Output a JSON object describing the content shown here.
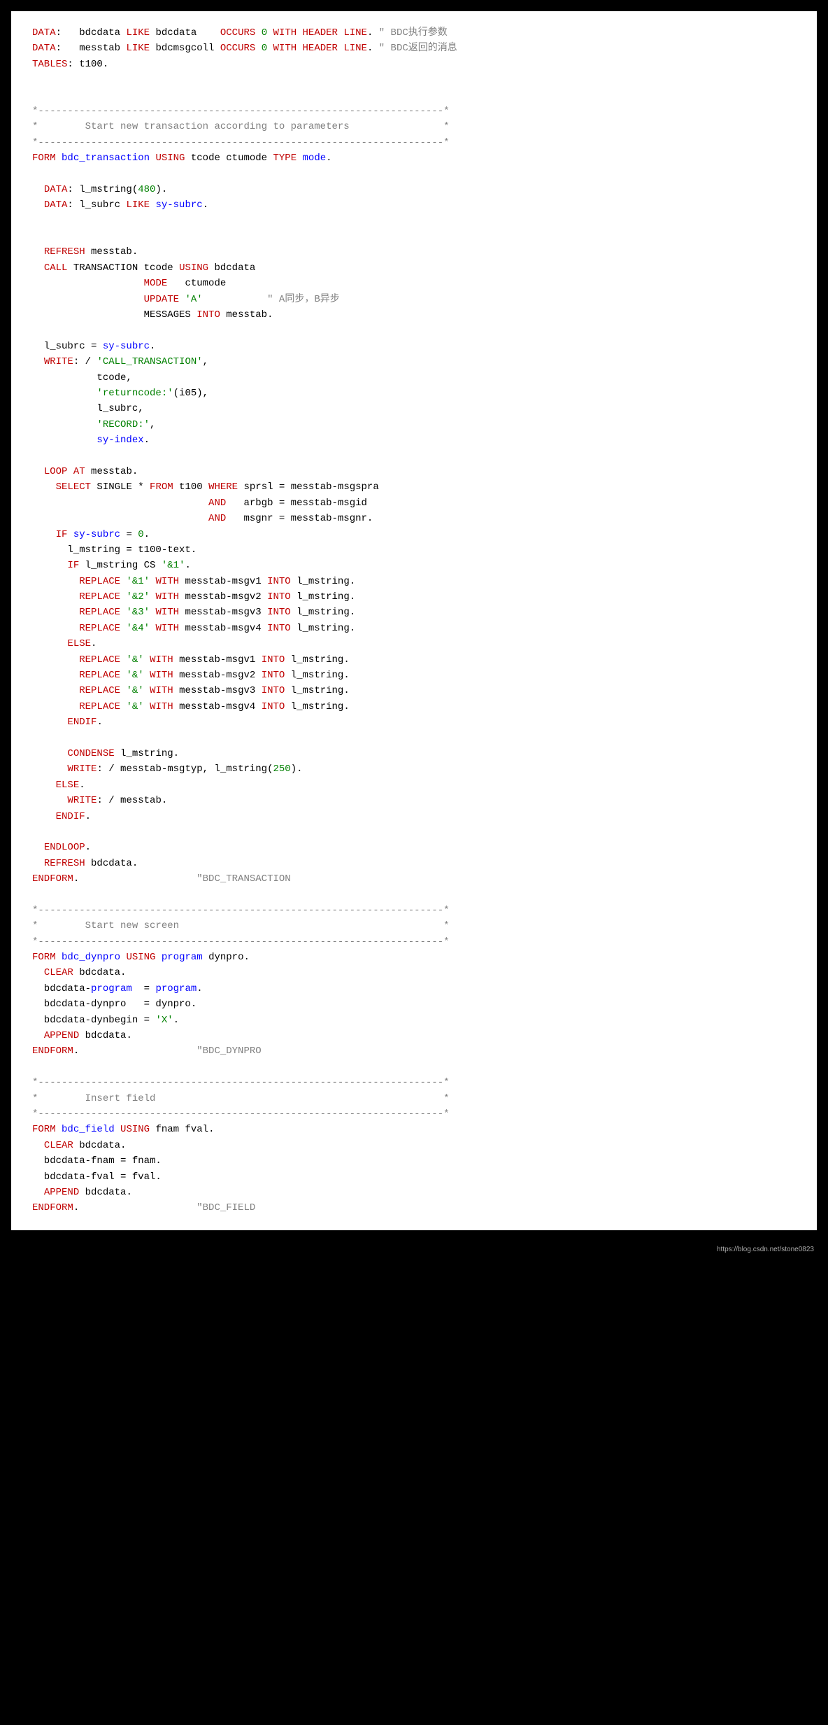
{
  "watermark": "https://blog.csdn.net/stone0823",
  "code": {
    "tokens": [
      [
        [
          "DATA",
          "red"
        ],
        [
          ":   bdcdata ",
          "black"
        ],
        [
          "LIKE",
          "red"
        ],
        [
          " bdcdata    ",
          "black"
        ],
        [
          "OCCURS",
          "red"
        ],
        [
          " ",
          "black"
        ],
        [
          "0",
          "green"
        ],
        [
          " ",
          "black"
        ],
        [
          "WITH HEADER LINE",
          "red"
        ],
        [
          ". ",
          "black"
        ],
        [
          "\" BDC执行参数",
          "gray"
        ]
      ],
      [
        [
          "DATA",
          "red"
        ],
        [
          ":   messtab ",
          "black"
        ],
        [
          "LIKE",
          "red"
        ],
        [
          " bdcmsgcoll ",
          "black"
        ],
        [
          "OCCURS",
          "red"
        ],
        [
          " ",
          "black"
        ],
        [
          "0",
          "green"
        ],
        [
          " ",
          "black"
        ],
        [
          "WITH HEADER LINE",
          "red"
        ],
        [
          ". ",
          "black"
        ],
        [
          "\" BDC返回的消息",
          "gray"
        ]
      ],
      [
        [
          "TABLES",
          "red"
        ],
        [
          ": t100.",
          "black"
        ]
      ],
      [
        [
          "",
          ""
        ]
      ],
      [
        [
          "",
          ""
        ]
      ],
      [
        [
          "*---------------------------------------------------------------------*",
          "gray"
        ]
      ],
      [
        [
          "*        Start new transaction according to parameters                *",
          "gray"
        ]
      ],
      [
        [
          "*---------------------------------------------------------------------*",
          "gray"
        ]
      ],
      [
        [
          "FORM",
          "red"
        ],
        [
          " ",
          "black"
        ],
        [
          "bdc_transaction",
          "blue"
        ],
        [
          " ",
          "black"
        ],
        [
          "USING",
          "red"
        ],
        [
          " tcode ctumode ",
          "black"
        ],
        [
          "TYPE",
          "red"
        ],
        [
          " ",
          "black"
        ],
        [
          "mode",
          "blue"
        ],
        [
          ".",
          "black"
        ]
      ],
      [
        [
          "",
          ""
        ]
      ],
      [
        [
          "  ",
          "black"
        ],
        [
          "DATA",
          "red"
        ],
        [
          ": l_mstring(",
          "black"
        ],
        [
          "480",
          "green"
        ],
        [
          ").",
          "black"
        ]
      ],
      [
        [
          "  ",
          "black"
        ],
        [
          "DATA",
          "red"
        ],
        [
          ": l_subrc ",
          "black"
        ],
        [
          "LIKE",
          "red"
        ],
        [
          " ",
          "black"
        ],
        [
          "sy-subrc",
          "blue"
        ],
        [
          ".",
          "black"
        ]
      ],
      [
        [
          "",
          ""
        ]
      ],
      [
        [
          "",
          ""
        ]
      ],
      [
        [
          "  ",
          "black"
        ],
        [
          "REFRESH",
          "red"
        ],
        [
          " messtab.",
          "black"
        ]
      ],
      [
        [
          "  ",
          "black"
        ],
        [
          "CALL",
          "red"
        ],
        [
          " TRANSACTION tcode ",
          "black"
        ],
        [
          "USING",
          "red"
        ],
        [
          " bdcdata",
          "black"
        ]
      ],
      [
        [
          "                   ",
          "black"
        ],
        [
          "MODE",
          "red"
        ],
        [
          "   ctumode",
          "black"
        ]
      ],
      [
        [
          "                   ",
          "black"
        ],
        [
          "UPDATE",
          "red"
        ],
        [
          " ",
          "black"
        ],
        [
          "'A'",
          "green"
        ],
        [
          "           ",
          "black"
        ],
        [
          "\" A同步，B异步",
          "gray"
        ]
      ],
      [
        [
          "                   MESSAGES ",
          "black"
        ],
        [
          "INTO",
          "red"
        ],
        [
          " messtab.",
          "black"
        ]
      ],
      [
        [
          "",
          ""
        ]
      ],
      [
        [
          "  l_subrc = ",
          "black"
        ],
        [
          "sy-subrc",
          "blue"
        ],
        [
          ".",
          "black"
        ]
      ],
      [
        [
          "  ",
          "black"
        ],
        [
          "WRITE",
          "red"
        ],
        [
          ": / ",
          "black"
        ],
        [
          "'CALL_TRANSACTION'",
          "green"
        ],
        [
          ",",
          "black"
        ]
      ],
      [
        [
          "           tcode,",
          "black"
        ]
      ],
      [
        [
          "           ",
          "black"
        ],
        [
          "'returncode:'",
          "green"
        ],
        [
          "(i05),",
          "black"
        ]
      ],
      [
        [
          "           l_subrc,",
          "black"
        ]
      ],
      [
        [
          "           ",
          "black"
        ],
        [
          "'RECORD:'",
          "green"
        ],
        [
          ",",
          "black"
        ]
      ],
      [
        [
          "           ",
          "black"
        ],
        [
          "sy-index",
          "blue"
        ],
        [
          ".",
          "black"
        ]
      ],
      [
        [
          "",
          ""
        ]
      ],
      [
        [
          "  ",
          "black"
        ],
        [
          "LOOP",
          "red"
        ],
        [
          " ",
          "black"
        ],
        [
          "AT",
          "red"
        ],
        [
          " messtab.",
          "black"
        ]
      ],
      [
        [
          "    ",
          "black"
        ],
        [
          "SELECT",
          "red"
        ],
        [
          " SINGLE * ",
          "black"
        ],
        [
          "FROM",
          "red"
        ],
        [
          " t100 ",
          "black"
        ],
        [
          "WHERE",
          "red"
        ],
        [
          " sprsl = messtab-msgspra",
          "black"
        ]
      ],
      [
        [
          "                              ",
          "black"
        ],
        [
          "AND",
          "red"
        ],
        [
          "   arbgb = messtab-msgid",
          "black"
        ]
      ],
      [
        [
          "                              ",
          "black"
        ],
        [
          "AND",
          "red"
        ],
        [
          "   msgnr = messtab-msgnr.",
          "black"
        ]
      ],
      [
        [
          "    ",
          "black"
        ],
        [
          "IF",
          "red"
        ],
        [
          " ",
          "black"
        ],
        [
          "sy-subrc",
          "blue"
        ],
        [
          " = ",
          "black"
        ],
        [
          "0",
          "green"
        ],
        [
          ".",
          "black"
        ]
      ],
      [
        [
          "      l_mstring = t100-text.",
          "black"
        ]
      ],
      [
        [
          "      ",
          "black"
        ],
        [
          "IF",
          "red"
        ],
        [
          " l_mstring CS ",
          "black"
        ],
        [
          "'&1'",
          "green"
        ],
        [
          ".",
          "black"
        ]
      ],
      [
        [
          "        ",
          "black"
        ],
        [
          "REPLACE",
          "red"
        ],
        [
          " ",
          "black"
        ],
        [
          "'&1'",
          "green"
        ],
        [
          " ",
          "black"
        ],
        [
          "WITH",
          "red"
        ],
        [
          " messtab-msgv1 ",
          "black"
        ],
        [
          "INTO",
          "red"
        ],
        [
          " l_mstring.",
          "black"
        ]
      ],
      [
        [
          "        ",
          "black"
        ],
        [
          "REPLACE",
          "red"
        ],
        [
          " ",
          "black"
        ],
        [
          "'&2'",
          "green"
        ],
        [
          " ",
          "black"
        ],
        [
          "WITH",
          "red"
        ],
        [
          " messtab-msgv2 ",
          "black"
        ],
        [
          "INTO",
          "red"
        ],
        [
          " l_mstring.",
          "black"
        ]
      ],
      [
        [
          "        ",
          "black"
        ],
        [
          "REPLACE",
          "red"
        ],
        [
          " ",
          "black"
        ],
        [
          "'&3'",
          "green"
        ],
        [
          " ",
          "black"
        ],
        [
          "WITH",
          "red"
        ],
        [
          " messtab-msgv3 ",
          "black"
        ],
        [
          "INTO",
          "red"
        ],
        [
          " l_mstring.",
          "black"
        ]
      ],
      [
        [
          "        ",
          "black"
        ],
        [
          "REPLACE",
          "red"
        ],
        [
          " ",
          "black"
        ],
        [
          "'&4'",
          "green"
        ],
        [
          " ",
          "black"
        ],
        [
          "WITH",
          "red"
        ],
        [
          " messtab-msgv4 ",
          "black"
        ],
        [
          "INTO",
          "red"
        ],
        [
          " l_mstring.",
          "black"
        ]
      ],
      [
        [
          "      ",
          "black"
        ],
        [
          "ELSE",
          "red"
        ],
        [
          ".",
          "black"
        ]
      ],
      [
        [
          "        ",
          "black"
        ],
        [
          "REPLACE",
          "red"
        ],
        [
          " ",
          "black"
        ],
        [
          "'&'",
          "green"
        ],
        [
          " ",
          "black"
        ],
        [
          "WITH",
          "red"
        ],
        [
          " messtab-msgv1 ",
          "black"
        ],
        [
          "INTO",
          "red"
        ],
        [
          " l_mstring.",
          "black"
        ]
      ],
      [
        [
          "        ",
          "black"
        ],
        [
          "REPLACE",
          "red"
        ],
        [
          " ",
          "black"
        ],
        [
          "'&'",
          "green"
        ],
        [
          " ",
          "black"
        ],
        [
          "WITH",
          "red"
        ],
        [
          " messtab-msgv2 ",
          "black"
        ],
        [
          "INTO",
          "red"
        ],
        [
          " l_mstring.",
          "black"
        ]
      ],
      [
        [
          "        ",
          "black"
        ],
        [
          "REPLACE",
          "red"
        ],
        [
          " ",
          "black"
        ],
        [
          "'&'",
          "green"
        ],
        [
          " ",
          "black"
        ],
        [
          "WITH",
          "red"
        ],
        [
          " messtab-msgv3 ",
          "black"
        ],
        [
          "INTO",
          "red"
        ],
        [
          " l_mstring.",
          "black"
        ]
      ],
      [
        [
          "        ",
          "black"
        ],
        [
          "REPLACE",
          "red"
        ],
        [
          " ",
          "black"
        ],
        [
          "'&'",
          "green"
        ],
        [
          " ",
          "black"
        ],
        [
          "WITH",
          "red"
        ],
        [
          " messtab-msgv4 ",
          "black"
        ],
        [
          "INTO",
          "red"
        ],
        [
          " l_mstring.",
          "black"
        ]
      ],
      [
        [
          "      ",
          "black"
        ],
        [
          "ENDIF",
          "red"
        ],
        [
          ".",
          "black"
        ]
      ],
      [
        [
          "",
          ""
        ]
      ],
      [
        [
          "      ",
          "black"
        ],
        [
          "CONDENSE",
          "red"
        ],
        [
          " l_mstring.",
          "black"
        ]
      ],
      [
        [
          "      ",
          "black"
        ],
        [
          "WRITE",
          "red"
        ],
        [
          ": / messtab-msgtyp, l_mstring(",
          "black"
        ],
        [
          "250",
          "green"
        ],
        [
          ").",
          "black"
        ]
      ],
      [
        [
          "    ",
          "black"
        ],
        [
          "ELSE",
          "red"
        ],
        [
          ".",
          "black"
        ]
      ],
      [
        [
          "      ",
          "black"
        ],
        [
          "WRITE",
          "red"
        ],
        [
          ": / messtab.",
          "black"
        ]
      ],
      [
        [
          "    ",
          "black"
        ],
        [
          "ENDIF",
          "red"
        ],
        [
          ".",
          "black"
        ]
      ],
      [
        [
          "",
          ""
        ]
      ],
      [
        [
          "  ",
          "black"
        ],
        [
          "ENDLOOP",
          "red"
        ],
        [
          ".",
          "black"
        ]
      ],
      [
        [
          "  ",
          "black"
        ],
        [
          "REFRESH",
          "red"
        ],
        [
          " bdcdata.",
          "black"
        ]
      ],
      [
        [
          "ENDFORM",
          "red"
        ],
        [
          ".                    ",
          "black"
        ],
        [
          "\"BDC_TRANSACTION",
          "gray"
        ]
      ],
      [
        [
          "",
          ""
        ]
      ],
      [
        [
          "*---------------------------------------------------------------------*",
          "gray"
        ]
      ],
      [
        [
          "*        Start new screen                                             *",
          "gray"
        ]
      ],
      [
        [
          "*---------------------------------------------------------------------*",
          "gray"
        ]
      ],
      [
        [
          "FORM",
          "red"
        ],
        [
          " ",
          "black"
        ],
        [
          "bdc_dynpro",
          "blue"
        ],
        [
          " ",
          "black"
        ],
        [
          "USING",
          "red"
        ],
        [
          " ",
          "black"
        ],
        [
          "program",
          "blue"
        ],
        [
          " dynpro.",
          "black"
        ]
      ],
      [
        [
          "  ",
          "black"
        ],
        [
          "CLEAR",
          "red"
        ],
        [
          " bdcdata.",
          "black"
        ]
      ],
      [
        [
          "  bdcdata-",
          "black"
        ],
        [
          "program",
          "blue"
        ],
        [
          "  = ",
          "black"
        ],
        [
          "program",
          "blue"
        ],
        [
          ".",
          "black"
        ]
      ],
      [
        [
          "  bdcdata-dynpro   = dynpro.",
          "black"
        ]
      ],
      [
        [
          "  bdcdata-dynbegin = ",
          "black"
        ],
        [
          "'X'",
          "green"
        ],
        [
          ".",
          "black"
        ]
      ],
      [
        [
          "  ",
          "black"
        ],
        [
          "APPEND",
          "red"
        ],
        [
          " bdcdata.",
          "black"
        ]
      ],
      [
        [
          "ENDFORM",
          "red"
        ],
        [
          ".                    ",
          "black"
        ],
        [
          "\"BDC_DYNPRO",
          "gray"
        ]
      ],
      [
        [
          "",
          ""
        ]
      ],
      [
        [
          "*---------------------------------------------------------------------*",
          "gray"
        ]
      ],
      [
        [
          "*        Insert field                                                 *",
          "gray"
        ]
      ],
      [
        [
          "*---------------------------------------------------------------------*",
          "gray"
        ]
      ],
      [
        [
          "FORM",
          "red"
        ],
        [
          " ",
          "black"
        ],
        [
          "bdc_field",
          "blue"
        ],
        [
          " ",
          "black"
        ],
        [
          "USING",
          "red"
        ],
        [
          " fnam fval.",
          "black"
        ]
      ],
      [
        [
          "  ",
          "black"
        ],
        [
          "CLEAR",
          "red"
        ],
        [
          " bdcdata.",
          "black"
        ]
      ],
      [
        [
          "  bdcdata-fnam = fnam.",
          "black"
        ]
      ],
      [
        [
          "  bdcdata-fval = fval.",
          "black"
        ]
      ],
      [
        [
          "  ",
          "black"
        ],
        [
          "APPEND",
          "red"
        ],
        [
          " bdcdata.",
          "black"
        ]
      ],
      [
        [
          "ENDFORM",
          "red"
        ],
        [
          ".                    ",
          "black"
        ],
        [
          "\"BDC_FIELD",
          "gray"
        ]
      ]
    ]
  }
}
